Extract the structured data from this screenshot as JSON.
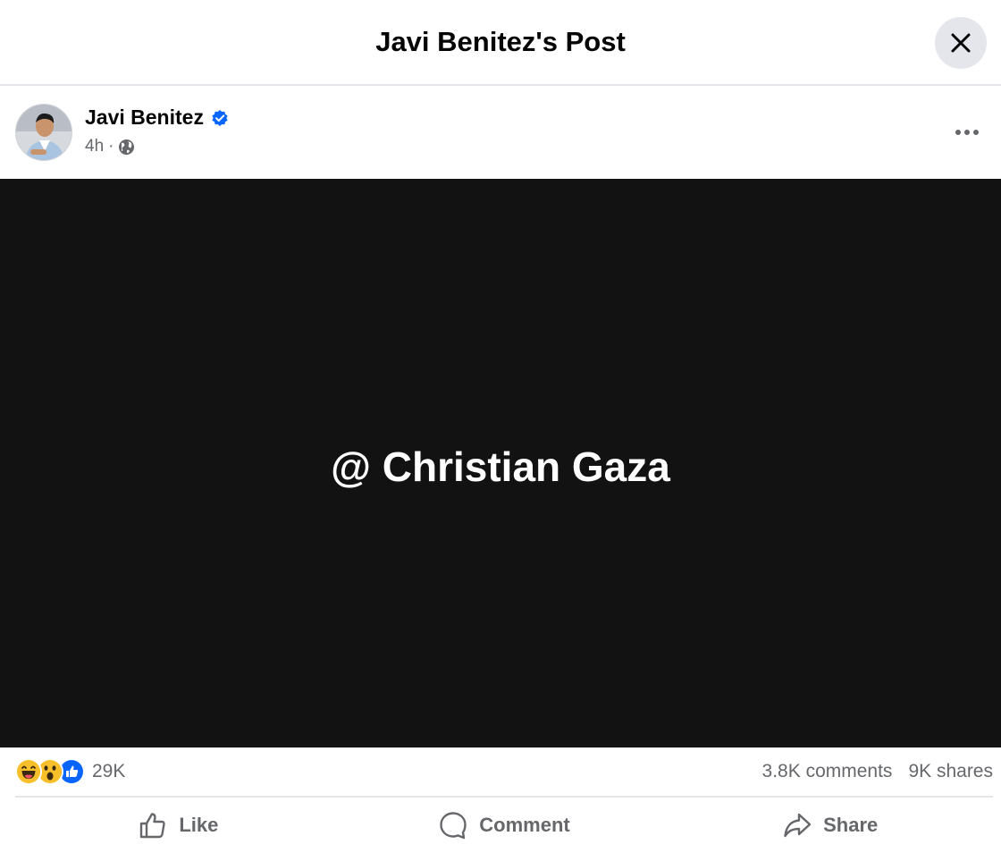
{
  "modal": {
    "title": "Javi Benitez's Post",
    "close_icon": "close-icon"
  },
  "post": {
    "author": "Javi Benitez",
    "verified_icon": "verified-badge-icon",
    "time": "4h",
    "separator": "·",
    "audience_icon": "globe-icon",
    "more_icon": "more-options-icon",
    "text": "@ Christian Gaza",
    "background_color": "#121212"
  },
  "stats": {
    "reactions": [
      "haha",
      "wow",
      "like"
    ],
    "reaction_count": "29K",
    "comments": "3.8K comments",
    "shares": "9K shares"
  },
  "actions": {
    "like": "Like",
    "comment": "Comment",
    "share": "Share"
  },
  "colors": {
    "accent": "#0866ff",
    "secondary_text": "#65676b",
    "divider": "#e4e6eb"
  }
}
